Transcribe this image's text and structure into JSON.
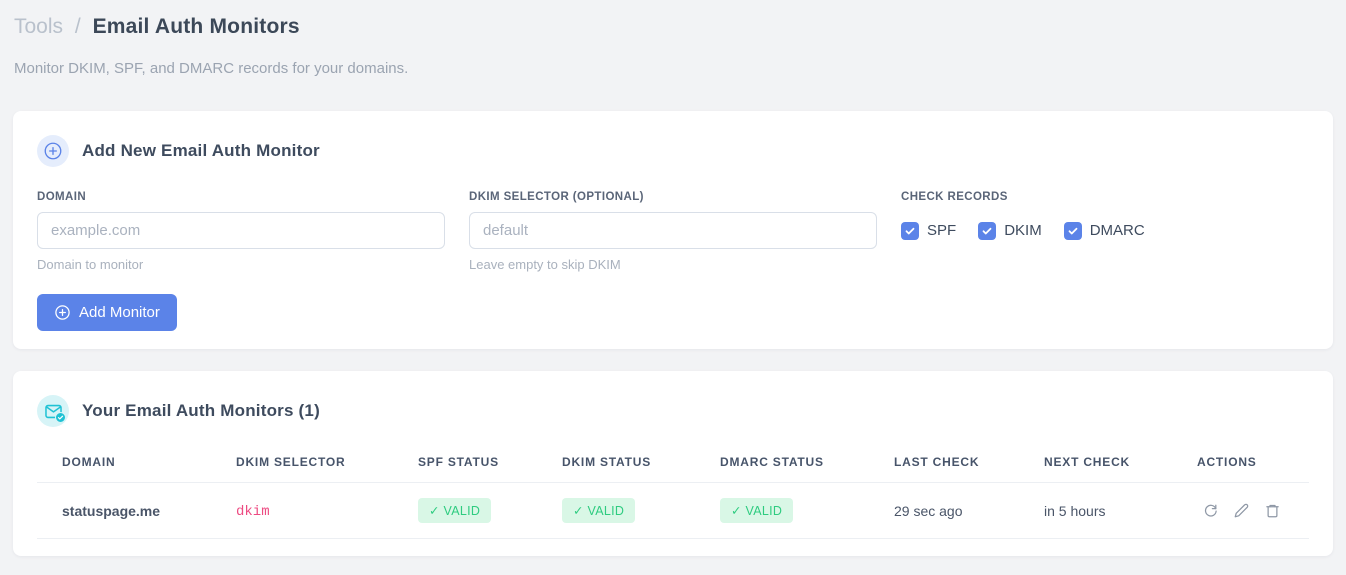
{
  "page": {
    "breadcrumb_root": "Tools",
    "breadcrumb_separator": "/",
    "title": "Email Auth Monitors",
    "subtitle": "Monitor DKIM, SPF, and DMARC records for your domains."
  },
  "add_form": {
    "title": "Add New Email Auth Monitor",
    "domain_field": {
      "label": "DOMAIN",
      "placeholder": "example.com",
      "value": "",
      "hint": "Domain to monitor"
    },
    "dkim_field": {
      "label": "DKIM SELECTOR (OPTIONAL)",
      "placeholder": "default",
      "value": "",
      "hint": "Leave empty to skip DKIM"
    },
    "check_records": {
      "label": "CHECK RECORDS",
      "options": [
        {
          "label": "SPF",
          "checked": true
        },
        {
          "label": "DKIM",
          "checked": true
        },
        {
          "label": "DMARC",
          "checked": true
        }
      ]
    },
    "submit_label": "Add Monitor"
  },
  "monitors": {
    "title": "Your Email Auth Monitors (1)",
    "count": 1,
    "columns": [
      "DOMAIN",
      "DKIM SELECTOR",
      "SPF STATUS",
      "DKIM STATUS",
      "DMARC STATUS",
      "LAST CHECK",
      "NEXT CHECK",
      "ACTIONS"
    ],
    "rows": [
      {
        "domain": "statuspage.me",
        "dkim_selector": "dkim",
        "spf_status": "✓ VALID",
        "dkim_status": "✓ VALID",
        "dmarc_status": "✓ VALID",
        "last_check": "29 sec ago",
        "next_check": "in 5 hours",
        "actions": [
          "refresh",
          "edit",
          "delete"
        ]
      }
    ]
  },
  "colors": {
    "accent_blue": "#5b83e8",
    "accent_cyan": "#1fc2d4",
    "status_valid_bg": "#d9f7e6",
    "status_valid_text": "#2ecc80",
    "code_pink": "#ed4b82",
    "page_bg": "#f2f3f5"
  }
}
